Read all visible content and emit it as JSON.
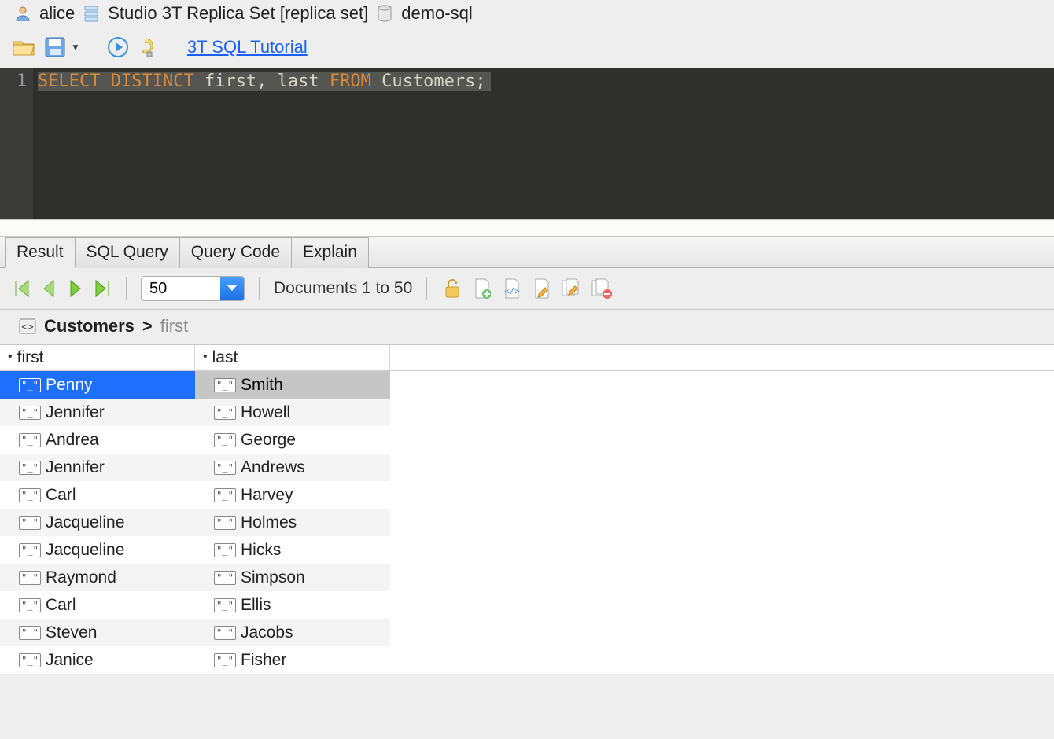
{
  "breadcrumb": {
    "user": "alice",
    "connection": "Studio 3T Replica Set [replica set]",
    "database": "demo-sql"
  },
  "toolbar": {
    "tutorial_link": "3T SQL Tutorial"
  },
  "editor": {
    "line_number": "1",
    "tokens": {
      "select": "SELECT",
      "distinct": "DISTINCT",
      "fields": "first, last",
      "from": "FROM",
      "table": "Customers;"
    }
  },
  "tabs": [
    {
      "label": "Result",
      "active": true
    },
    {
      "label": "SQL Query",
      "active": false
    },
    {
      "label": "Query Code",
      "active": false
    },
    {
      "label": "Explain",
      "active": false
    }
  ],
  "result_toolbar": {
    "page_size": "50",
    "documents_label": "Documents 1 to 50"
  },
  "collection_breadcrumb": {
    "collection": "Customers",
    "angle": ">",
    "field": "first"
  },
  "columns": [
    {
      "name": "first"
    },
    {
      "name": "last"
    }
  ],
  "type_badge": "\"_\"",
  "rows": [
    {
      "first": "Penny",
      "last": "Smith",
      "selected": true
    },
    {
      "first": "Jennifer",
      "last": "Howell"
    },
    {
      "first": "Andrea",
      "last": "George"
    },
    {
      "first": "Jennifer",
      "last": "Andrews"
    },
    {
      "first": "Carl",
      "last": "Harvey"
    },
    {
      "first": "Jacqueline",
      "last": "Holmes"
    },
    {
      "first": "Jacqueline",
      "last": "Hicks"
    },
    {
      "first": "Raymond",
      "last": "Simpson"
    },
    {
      "first": "Carl",
      "last": "Ellis"
    },
    {
      "first": "Steven",
      "last": "Jacobs"
    },
    {
      "first": "Janice",
      "last": "Fisher"
    }
  ]
}
